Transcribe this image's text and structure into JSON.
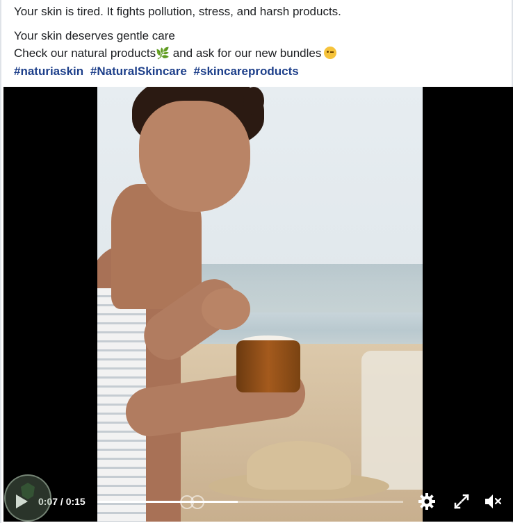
{
  "post": {
    "line1": "Your skin is tired. It fights pollution, stress, and harsh products.",
    "line2": "Your skin deserves gentle care",
    "line3_text": "Check our natural products",
    "line3_after": " and ask for our new bundles",
    "hashtags": [
      "#naturiaskin",
      "#NaturalSkincare",
      "#skincareproducts"
    ],
    "emoji_leaf": "🌿"
  },
  "video": {
    "time_display": "0:07 / 0:15",
    "progress": 0.46
  },
  "icons": {
    "play": "play-icon",
    "settings": "gear-icon",
    "fullscreen": "expand-icon",
    "volume": "muted-speaker-icon",
    "watermark": "shield-logo"
  },
  "colors": {
    "hashtag": "#1d3f8a",
    "text": "#1c1e21",
    "video_bg": "#000000"
  }
}
